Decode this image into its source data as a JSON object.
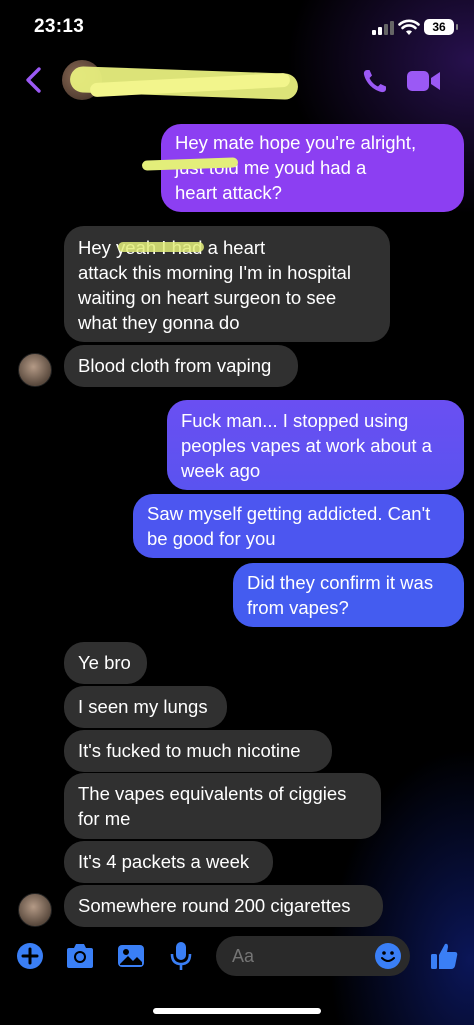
{
  "status_bar": {
    "time": "23:13",
    "battery": "36"
  },
  "header": {
    "contact_name": "",
    "icons": [
      "back-chevron-icon",
      "phone-icon",
      "video-camera-icon"
    ]
  },
  "messages": [
    {
      "from": "me",
      "text": "Hey mate hope you're alright,\n              just told me youd had a\nheart attack?"
    },
    {
      "from": "them",
      "text": "Hey          yeah I had a heart\nattack this morning I'm in hospital\nwaiting on heart surgeon to see\nwhat they gonna do"
    },
    {
      "from": "them",
      "text": "Blood cloth from vaping"
    },
    {
      "from": "me",
      "text": "Fuck man... I stopped using\npeoples vapes at work about a\nweek ago"
    },
    {
      "from": "me",
      "text": "Saw myself getting addicted. Can't\nbe good for you"
    },
    {
      "from": "me",
      "text": "Did they confirm it was\nfrom vapes?"
    },
    {
      "from": "them",
      "text": "Ye bro"
    },
    {
      "from": "them",
      "text": "I seen my lungs"
    },
    {
      "from": "them",
      "text": "It's fucked to much nicotine"
    },
    {
      "from": "them",
      "text": "The vapes equivalents of ciggies\nfor me"
    },
    {
      "from": "them",
      "text": "It's 4 packets a week"
    },
    {
      "from": "them",
      "text": "Somewhere round 200 cigarettes"
    }
  ],
  "composer": {
    "placeholder": "Aa",
    "icons": [
      "plus-icon",
      "camera-icon",
      "gallery-icon",
      "microphone-icon",
      "emoji-icon",
      "thumbs-up-icon"
    ]
  },
  "colors": {
    "accent": "#8b5cf6",
    "outgoing_top": "#8a3ff0",
    "outgoing_bottom": "#3f5ef0",
    "incoming": "#303030",
    "composer_icon": "#3b82f6"
  }
}
